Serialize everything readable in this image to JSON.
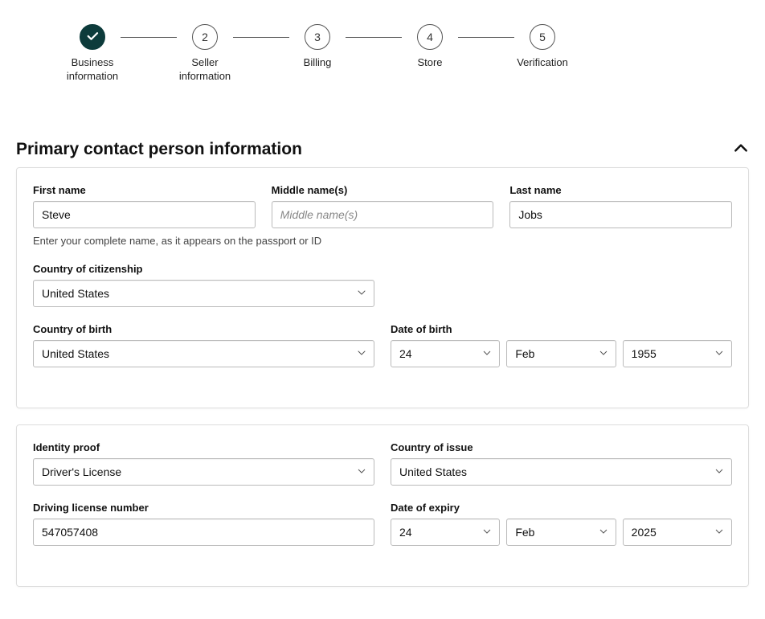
{
  "stepper": {
    "step1": {
      "label": "Business information"
    },
    "step2": {
      "number": "2",
      "label": "Seller information"
    },
    "step3": {
      "number": "3",
      "label": "Billing"
    },
    "step4": {
      "number": "4",
      "label": "Store"
    },
    "step5": {
      "number": "5",
      "label": "Verification"
    }
  },
  "section": {
    "title": "Primary contact person information"
  },
  "card1": {
    "first_name": {
      "label": "First name",
      "value": "Steve"
    },
    "middle_name": {
      "label": "Middle name(s)",
      "placeholder": "Middle name(s)",
      "value": ""
    },
    "last_name": {
      "label": "Last name",
      "value": "Jobs"
    },
    "name_hint": "Enter your complete name, as it appears on the passport or ID",
    "citizenship": {
      "label": "Country of citizenship",
      "value": "United States"
    },
    "birth_country": {
      "label": "Country of birth",
      "value": "United States"
    },
    "dob": {
      "label": "Date of birth",
      "day": "24",
      "month": "Feb",
      "year": "1955"
    }
  },
  "card2": {
    "id_proof": {
      "label": "Identity proof",
      "value": "Driver's License"
    },
    "issue_country": {
      "label": "Country of issue",
      "value": "United States"
    },
    "license_number": {
      "label": "Driving license number",
      "value": "547057408"
    },
    "expiry": {
      "label": "Date of expiry",
      "day": "24",
      "month": "Feb",
      "year": "2025"
    }
  }
}
